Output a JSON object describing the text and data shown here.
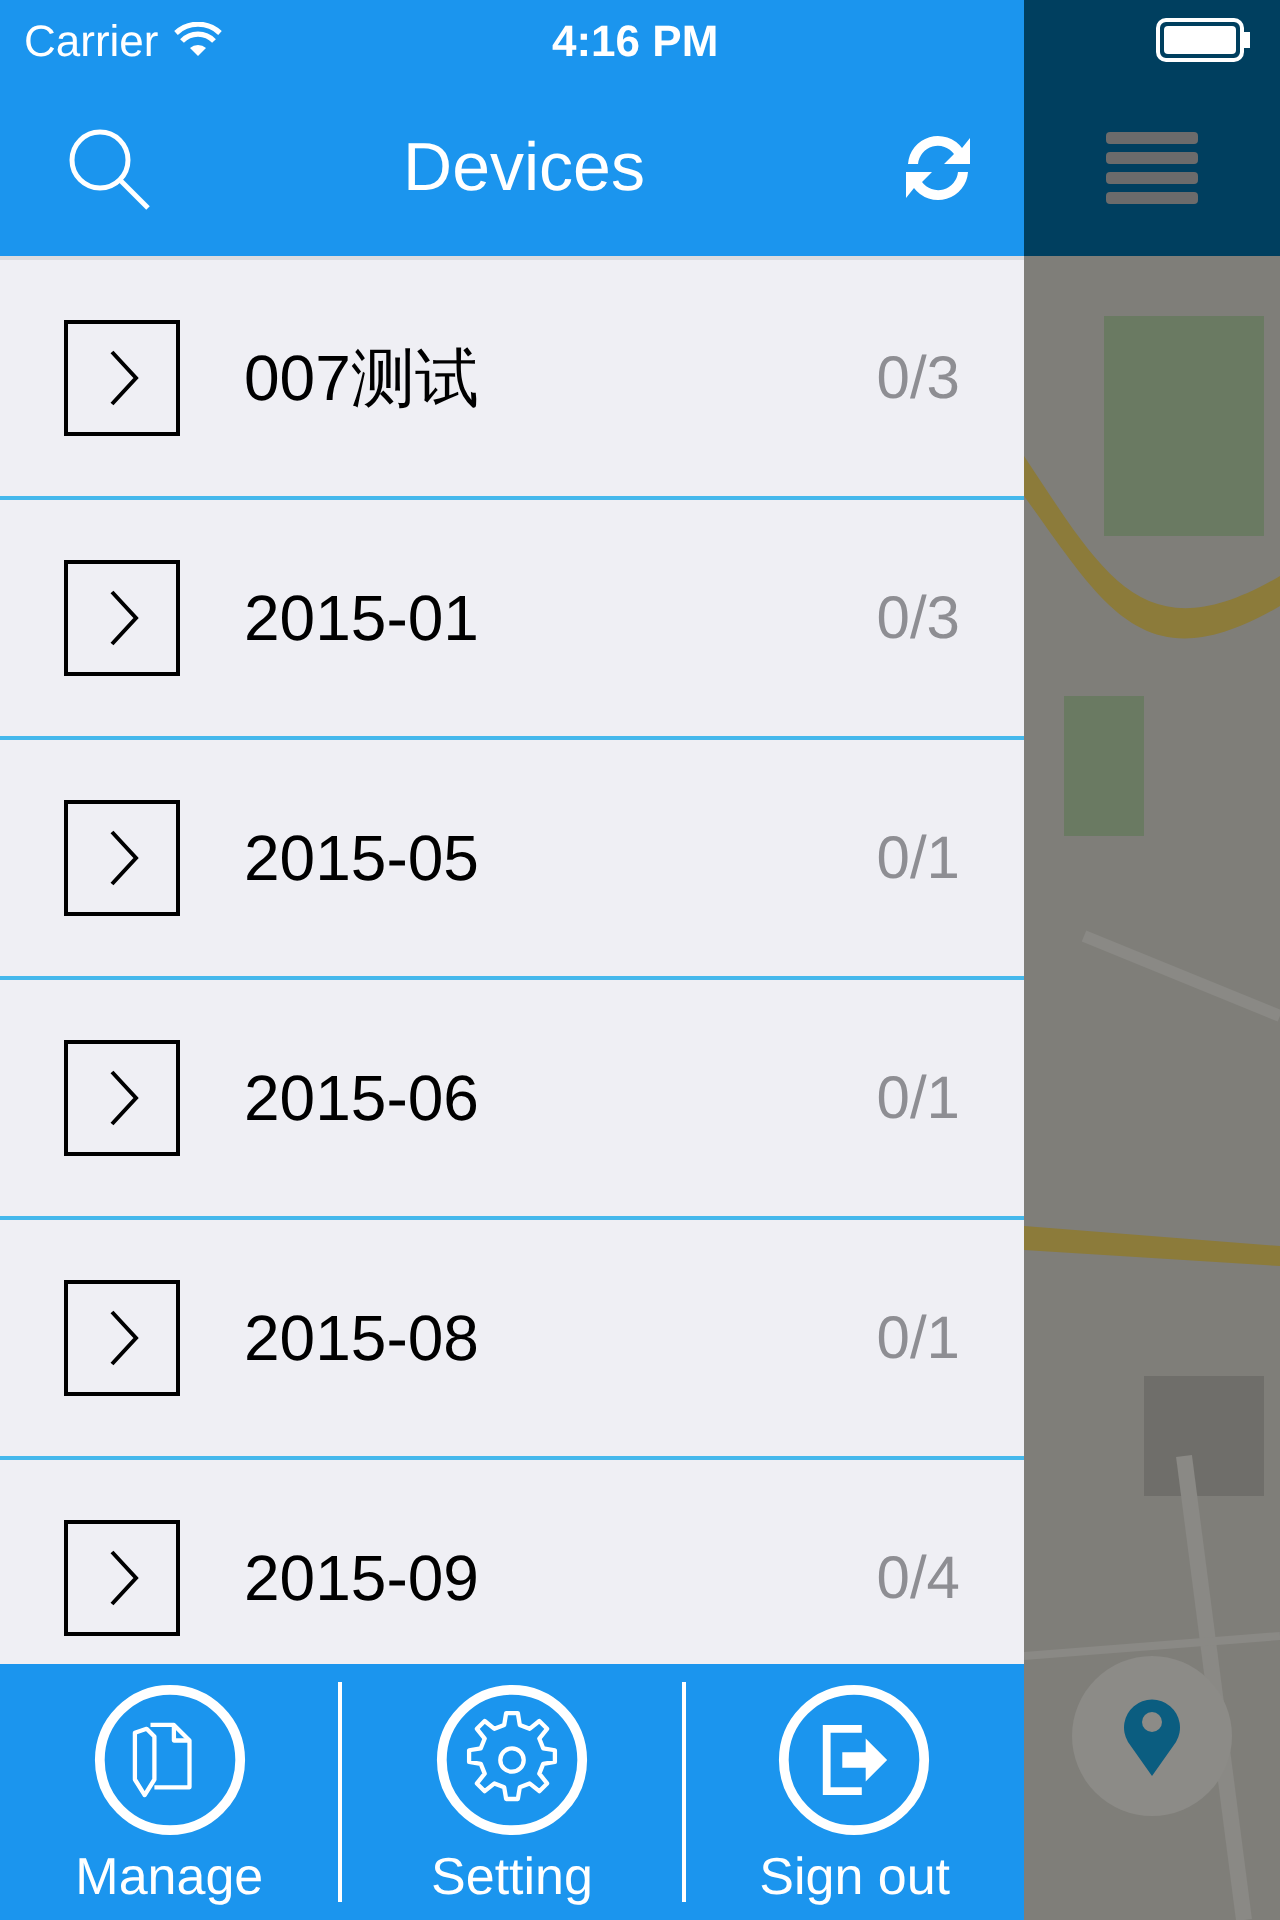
{
  "status_bar": {
    "carrier": "Carrier",
    "time": "4:16 PM"
  },
  "nav": {
    "title": "Devices"
  },
  "groups": [
    {
      "name": "007测试",
      "count": "0/3"
    },
    {
      "name": "2015-01",
      "count": "0/3"
    },
    {
      "name": "2015-05",
      "count": "0/1"
    },
    {
      "name": "2015-06",
      "count": "0/1"
    },
    {
      "name": "2015-08",
      "count": "0/1"
    },
    {
      "name": "2015-09",
      "count": "0/4"
    }
  ],
  "toolbar": [
    {
      "label": "Manage",
      "kind": "manage"
    },
    {
      "label": "Setting",
      "kind": "setting"
    },
    {
      "label": "Sign out",
      "kind": "signout"
    }
  ]
}
